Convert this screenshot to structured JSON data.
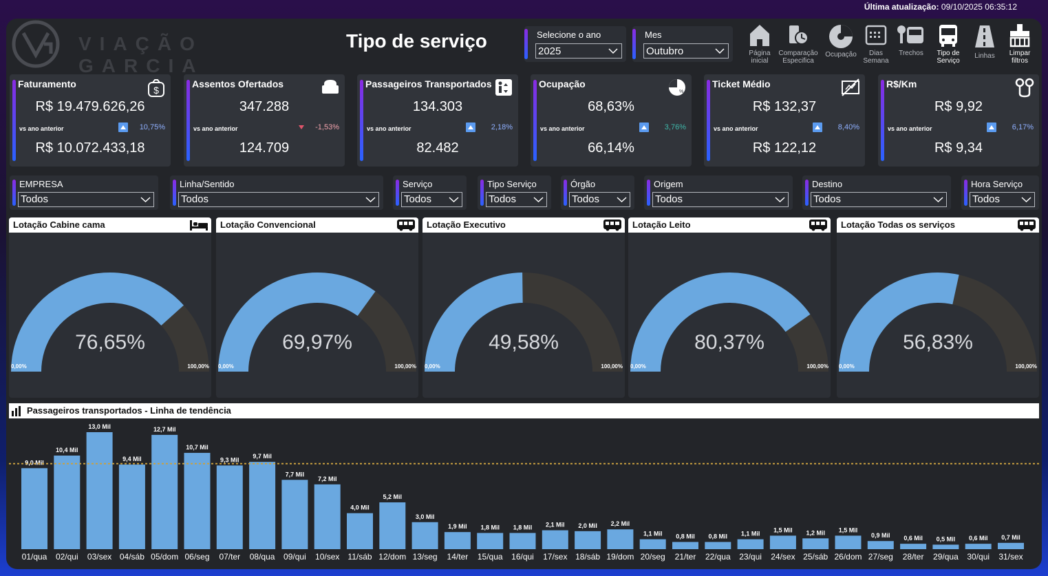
{
  "header": {
    "last_update_label": "Última atualização:",
    "last_update_value": "09/10/2025 06:35:12",
    "logo_text": "VIAÇÃO GARCIA",
    "page_title": "Tipo de serviço"
  },
  "filters_top": {
    "year_label": "Selecione o ano",
    "year_value": "2025",
    "month_label": "Mes",
    "month_value": "Outubro"
  },
  "nav": [
    {
      "label": "Página inicial",
      "icon": "home-icon"
    },
    {
      "label": "Comparação Especifica",
      "icon": "comparison-icon"
    },
    {
      "label": "Ocupação",
      "icon": "pie-icon"
    },
    {
      "label": "Dias Semana",
      "icon": "calendar-icon"
    },
    {
      "label": "Trechos",
      "icon": "route-icon"
    },
    {
      "label": "Tipo de Serviço",
      "icon": "bus-icon"
    },
    {
      "label": "Linhas",
      "icon": "road-icon"
    },
    {
      "label": "Limpar filtros",
      "icon": "eraser-icon"
    }
  ],
  "kpis": [
    {
      "title": "Faturamento",
      "value": "R$ 19.479.626,26",
      "vs_label": "vs ano anterior",
      "change": "10,75%",
      "direction": "up",
      "prev": "R$ 10.072.433,18",
      "icon": "money-bag-icon"
    },
    {
      "title": "Assentos Ofertados",
      "value": "347.288",
      "vs_label": "vs ano anterior",
      "change": "-1,53%",
      "direction": "down",
      "prev": "124.709",
      "icon": "seat-icon"
    },
    {
      "title": "Passageiros Transportados",
      "value": "134.303",
      "vs_label": "vs ano anterior",
      "change": "2,18%",
      "direction": "up",
      "prev": "82.482",
      "icon": "passenger-icon"
    },
    {
      "title": "Ocupação",
      "value": "68,63%",
      "vs_label": "vs ano anterior",
      "change": "3,76%",
      "direction": "up",
      "prev": "66,14%",
      "icon": "occupancy-pie-icon"
    },
    {
      "title": "Ticket Médio",
      "value": "R$ 132,37",
      "vs_label": "vs ano anterior",
      "change": "8,40%",
      "direction": "up",
      "prev": "R$ 122,12",
      "icon": "ticket-icon"
    },
    {
      "title": "R$/Km",
      "value": "R$ 9,92",
      "vs_label": "vs ano anterior",
      "change": "6,17%",
      "direction": "up",
      "prev": "R$ 9,34",
      "icon": "map-pin-icon"
    }
  ],
  "slicers": [
    {
      "label": "EMPRESA",
      "value": "Todos"
    },
    {
      "label": "Linha/Sentido",
      "value": "Todos"
    },
    {
      "label": "Serviço",
      "value": "Todos"
    },
    {
      "label": "Tipo Serviço",
      "value": "Todos"
    },
    {
      "label": "Órgão",
      "value": "Todos"
    },
    {
      "label": "Origem",
      "value": "Todos"
    },
    {
      "label": "Destino",
      "value": "Todos"
    },
    {
      "label": "Hora Serviço",
      "value": "Todos"
    }
  ],
  "gauges": [
    {
      "title": "Lotação Cabine cama",
      "value": 76.65,
      "display": "76,65%",
      "min": "0,00%",
      "max": "100,00%",
      "icon": "bed-icon"
    },
    {
      "title": "Lotação Convencional",
      "value": 69.97,
      "display": "69,97%",
      "min": "0,00%",
      "max": "100,00%",
      "icon": "bus-icon"
    },
    {
      "title": "Lotação Executivo",
      "value": 49.58,
      "display": "49,58%",
      "min": "0,00%",
      "max": "100,00%",
      "icon": "bus-icon"
    },
    {
      "title": "Lotação Leito",
      "value": 80.37,
      "display": "80,37%",
      "min": "0,00%",
      "max": "100,00%",
      "icon": "bus-icon"
    },
    {
      "title": "Lotação Todas os serviços",
      "value": 56.83,
      "display": "56,83%",
      "min": "0,00%",
      "max": "100,00%",
      "icon": "bus-icon"
    }
  ],
  "colors": {
    "accent": "#6aa8e0",
    "gauge_rest": "#3a3835",
    "panel": "#232529",
    "card": "#31343a",
    "trend": "#c9a040"
  },
  "chart_data": {
    "type": "bar",
    "title": "Passageiros transportados - Linha de tendência",
    "categories": [
      "01/qua",
      "02/qui",
      "03/sex",
      "04/sáb",
      "05/dom",
      "06/seg",
      "07/ter",
      "08/qua",
      "09/qui",
      "10/sex",
      "11/sáb",
      "12/dom",
      "13/seg",
      "14/ter",
      "15/qua",
      "16/qui",
      "17/sex",
      "18/sáb",
      "19/dom",
      "20/seg",
      "21/ter",
      "22/qua",
      "23/qui",
      "24/sex",
      "25/sáb",
      "26/dom",
      "27/seg",
      "28/ter",
      "29/qua",
      "30/qui",
      "31/sex"
    ],
    "values": [
      9.0,
      10.4,
      13.0,
      9.4,
      12.7,
      10.7,
      9.3,
      9.7,
      7.7,
      7.2,
      4.0,
      5.2,
      3.0,
      1.9,
      1.8,
      1.8,
      2.1,
      2.0,
      2.2,
      1.1,
      0.8,
      0.8,
      1.1,
      1.5,
      1.2,
      1.5,
      0.9,
      0.6,
      0.5,
      0.6,
      0.7
    ],
    "labels": [
      "9,0 Mil",
      "10,4 Mil",
      "13,0 Mil",
      "9,4 Mil",
      "12,7 Mil",
      "10,7 Mil",
      "9,3 Mil",
      "9,7 Mil",
      "7,7 Mil",
      "7,2 Mil",
      "4,0 Mil",
      "5,2 Mil",
      "3,0 Mil",
      "1,9 Mil",
      "1,8 Mil",
      "1,8 Mil",
      "2,1 Mil",
      "2,0 Mil",
      "2,2 Mil",
      "1,1 Mil",
      "0,8 Mil",
      "0,8 Mil",
      "1,1 Mil",
      "1,5 Mil",
      "1,2 Mil",
      "1,5 Mil",
      "0,9 Mil",
      "0,6 Mil",
      "0,5 Mil",
      "0,6 Mil",
      "0,7 Mil"
    ],
    "trend_value": 9.5,
    "ylim": [
      0,
      13.0
    ],
    "unit": "Mil"
  }
}
